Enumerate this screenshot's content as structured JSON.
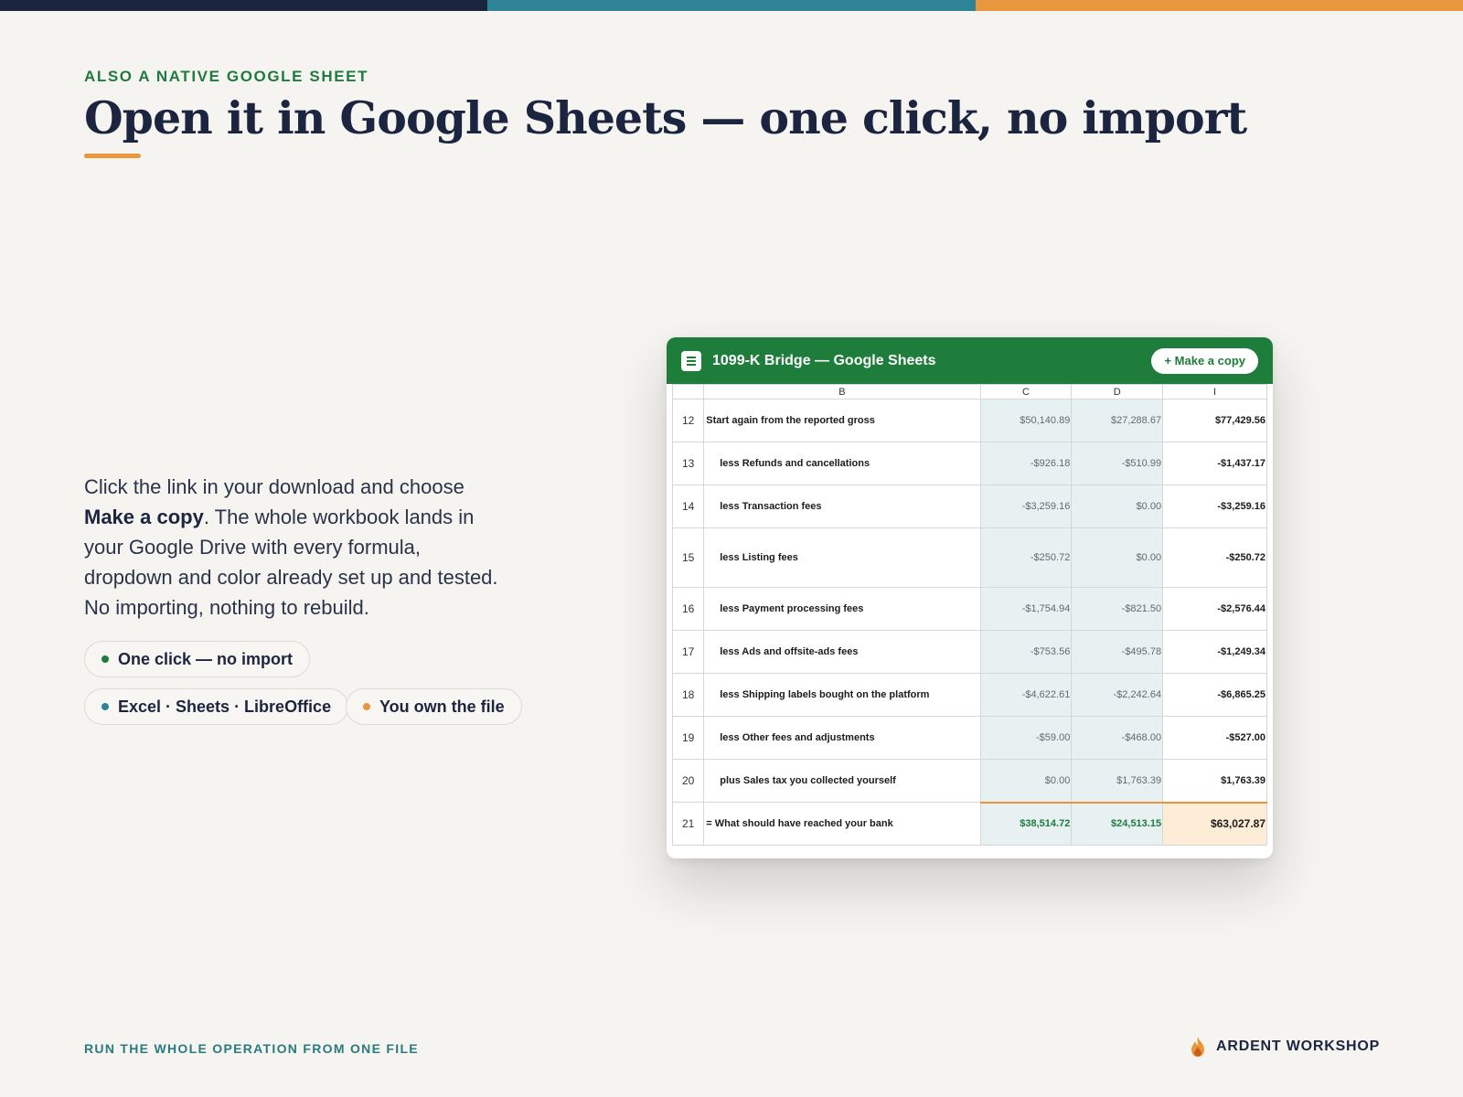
{
  "colors": {
    "navy": "#1c2540",
    "teal": "#2f8396",
    "orange": "#e8973c",
    "green": "#1e7d3b"
  },
  "eyebrow": "ALSO A NATIVE GOOGLE SHEET",
  "title": "Open it in Google Sheets — one click, no import",
  "body": {
    "part1": "Click the link in your download and choose ",
    "bold": "Make a copy",
    "part2": ". The whole workbook lands in your Google Drive with every formula, dropdown and color already set up and tested. No importing, nothing to rebuild."
  },
  "pills": [
    {
      "label": "One click — no import",
      "dot_color": "#1e7d3b"
    },
    {
      "label": "Excel · Sheets · LibreOffice",
      "dot_color": "#2f8396"
    },
    {
      "label": "You own the file",
      "dot_color": "#e8973c"
    }
  ],
  "sheet": {
    "title": "1099-K Bridge — Google Sheets",
    "copy_button": "+ Make a copy",
    "columns": [
      "",
      "B",
      "C",
      "D",
      "I"
    ],
    "rows": [
      {
        "n": "12",
        "label": "Start again from the reported gross",
        "c": "$50,140.89",
        "d": "$27,288.67",
        "i": "$77,429.56"
      },
      {
        "n": "13",
        "label": "less  Refunds and cancellations",
        "c": "-$926.18",
        "d": "-$510.99",
        "i": "-$1,437.17"
      },
      {
        "n": "14",
        "label": "less  Transaction fees",
        "c": "-$3,259.16",
        "d": "$0.00",
        "i": "-$3,259.16"
      },
      {
        "n": "15",
        "label": "less  Listing fees",
        "c": "-$250.72",
        "d": "$0.00",
        "i": "-$250.72"
      },
      {
        "n": "16",
        "label": "less  Payment processing fees",
        "c": "-$1,754.94",
        "d": "-$821.50",
        "i": "-$2,576.44"
      },
      {
        "n": "17",
        "label": "less  Ads and offsite-ads fees",
        "c": "-$753.56",
        "d": "-$495.78",
        "i": "-$1,249.34"
      },
      {
        "n": "18",
        "label": "less  Shipping labels bought on the platform",
        "c": "-$4,622.61",
        "d": "-$2,242.64",
        "i": "-$6,865.25"
      },
      {
        "n": "19",
        "label": "less  Other fees and adjustments",
        "c": "-$59.00",
        "d": "-$468.00",
        "i": "-$527.00"
      },
      {
        "n": "20",
        "label": "plus  Sales tax you collected yourself",
        "c": "$0.00",
        "d": "$1,763.39",
        "i": "$1,763.39"
      },
      {
        "n": "21",
        "label": "= What should have reached your bank",
        "c": "$38,514.72",
        "d": "$24,513.15",
        "i": "$63,027.87"
      }
    ]
  },
  "footer": {
    "tagline": "RUN THE WHOLE OPERATION FROM ONE FILE",
    "brand": "ARDENT WORKSHOP",
    "brand_icon": "flame-icon"
  }
}
